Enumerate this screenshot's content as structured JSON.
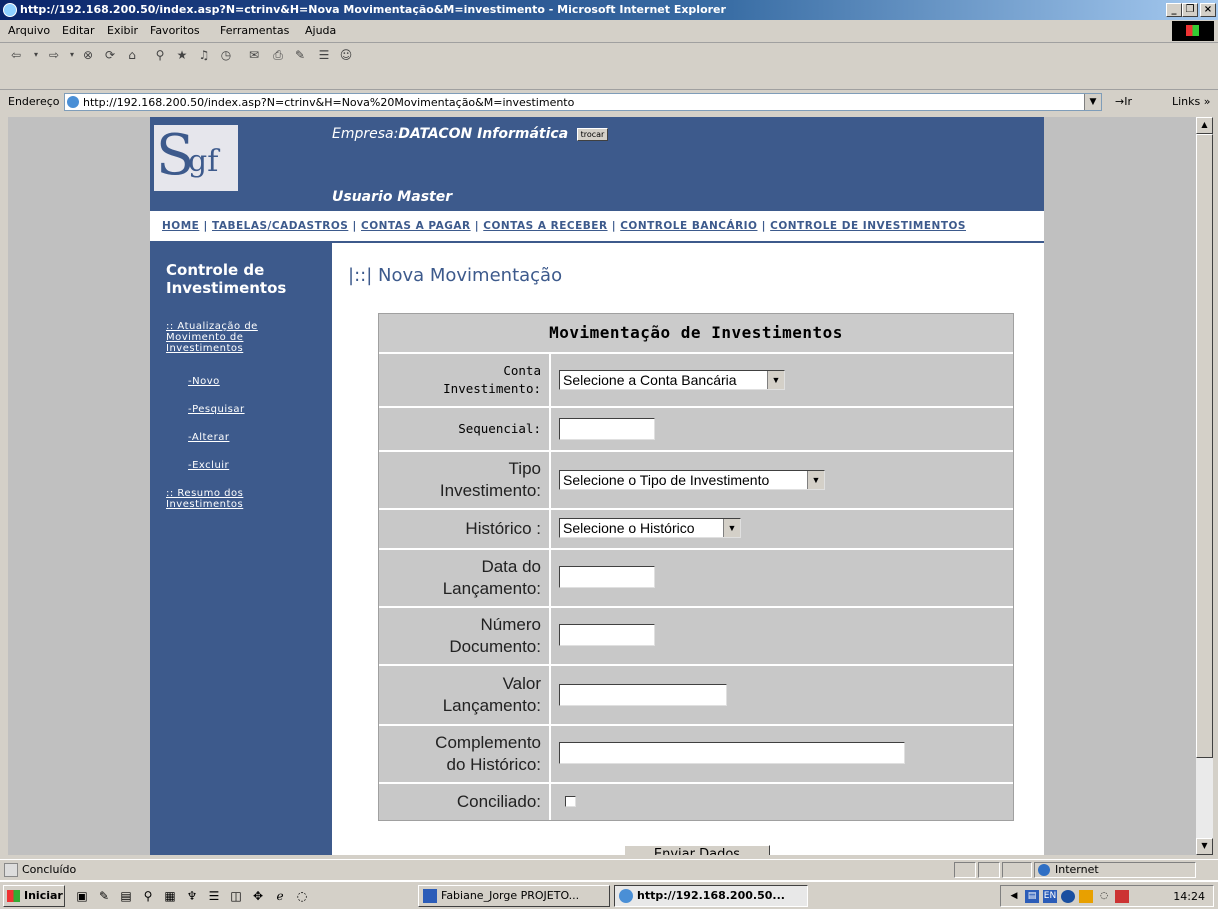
{
  "window": {
    "title": "http://192.168.200.50/index.asp?N=ctrinv&H=Nova Movimentação&M=investimento - Microsoft Internet Explorer",
    "min": "_",
    "max": "❐",
    "close": "×"
  },
  "menu": [
    "Arquivo",
    "Editar",
    "Exibir",
    "Favoritos",
    "Ferramentas",
    "Ajuda"
  ],
  "addressbar": {
    "label": "Endereço",
    "url": "http://192.168.200.50/index.asp?N=ctrinv&H=Nova%20Movimentação&M=investimento",
    "go": "→Ir",
    "links": "Links »"
  },
  "site": {
    "logo_s": "S",
    "logo_gf": "gf",
    "empresa_label": "Empresa:",
    "empresa_name": "DATACON Informática",
    "trocar": "trocar",
    "usuario": "Usuario Master",
    "nav": [
      "HOME",
      "TABELAS/CADASTROS",
      "CONTAS A PAGAR",
      "CONTAS A RECEBER",
      "CONTROLE BANCÁRIO",
      "CONTROLE DE INVESTIMENTOS"
    ],
    "nav_sep": " | ",
    "sidebar": {
      "title": "Controle de Investimentos",
      "section1": ":: Atualização de Movimento de Investimentos",
      "novo": "-Novo",
      "pesquisar": "-Pesquisar",
      "alterar": "-Alterar",
      "excluir": "-Excluir",
      "section2": ":: Resumo dos Investimentos"
    },
    "page_title": "|::| Nova Movimentação"
  },
  "form": {
    "heading": "Movimentação de Investimentos",
    "conta_l1": "Conta",
    "conta_l2": "Investimento:",
    "conta_value": "Selecione a Conta Bancária",
    "sequencial": "Sequencial:",
    "tipo_l1": "Tipo",
    "tipo_l2": "Investimento:",
    "tipo_value": "Selecione o Tipo de Investimento",
    "historico": "Histórico :",
    "historico_value": "Selecione o Histórico",
    "data_l1": "Data do",
    "data_l2": "Lançamento:",
    "numero_l1": "Número",
    "numero_l2": "Documento:",
    "valor_l1": "Valor",
    "valor_l2": "Lançamento:",
    "compl_l1": "Complemento",
    "compl_l2": "do Histórico:",
    "conciliado": "Conciliado:",
    "submit": "Enviar Dados"
  },
  "status": {
    "text": "Concluído",
    "zone": "Internet"
  },
  "taskbar": {
    "start": "Iniciar",
    "task1": "Fabiane_Jorge PROJETO...",
    "task2": "http://192.168.200.50...",
    "clock": "14:24",
    "lang": "EN"
  }
}
